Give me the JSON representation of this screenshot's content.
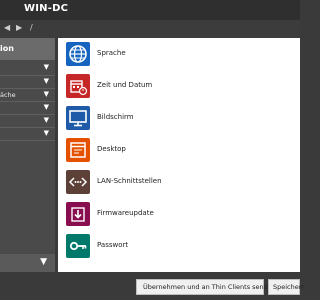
{
  "window": {
    "title": "WIN-DC"
  },
  "breadcrumb": {
    "separator": "/"
  },
  "sidebar": {
    "header": "ion",
    "items": [
      {
        "label": ""
      },
      {
        "label": ""
      },
      {
        "label": "äche"
      },
      {
        "label": ""
      },
      {
        "label": ""
      },
      {
        "label": ""
      }
    ]
  },
  "tiles": [
    {
      "label": "Sprache",
      "icon": "globe-icon",
      "color": "#1565c0"
    },
    {
      "label": "Zeit und Datum",
      "icon": "calendar-clock-icon",
      "color": "#c62828"
    },
    {
      "label": "Bildschirm",
      "icon": "monitor-icon",
      "color": "#1e5aa8"
    },
    {
      "label": "Desktop",
      "icon": "desktop-window-icon",
      "color": "#e65100"
    },
    {
      "label": "LAN-Schnittstellen",
      "icon": "network-icon",
      "color": "#5d4037"
    },
    {
      "label": "Firmwareupdate",
      "icon": "download-box-icon",
      "color": "#880e4f"
    },
    {
      "label": "Passwort",
      "icon": "key-icon",
      "color": "#00796b"
    }
  ],
  "footer": {
    "apply_send_label": "Übernehmen und an Thin Clients senden",
    "save_label": "Speicherr"
  }
}
